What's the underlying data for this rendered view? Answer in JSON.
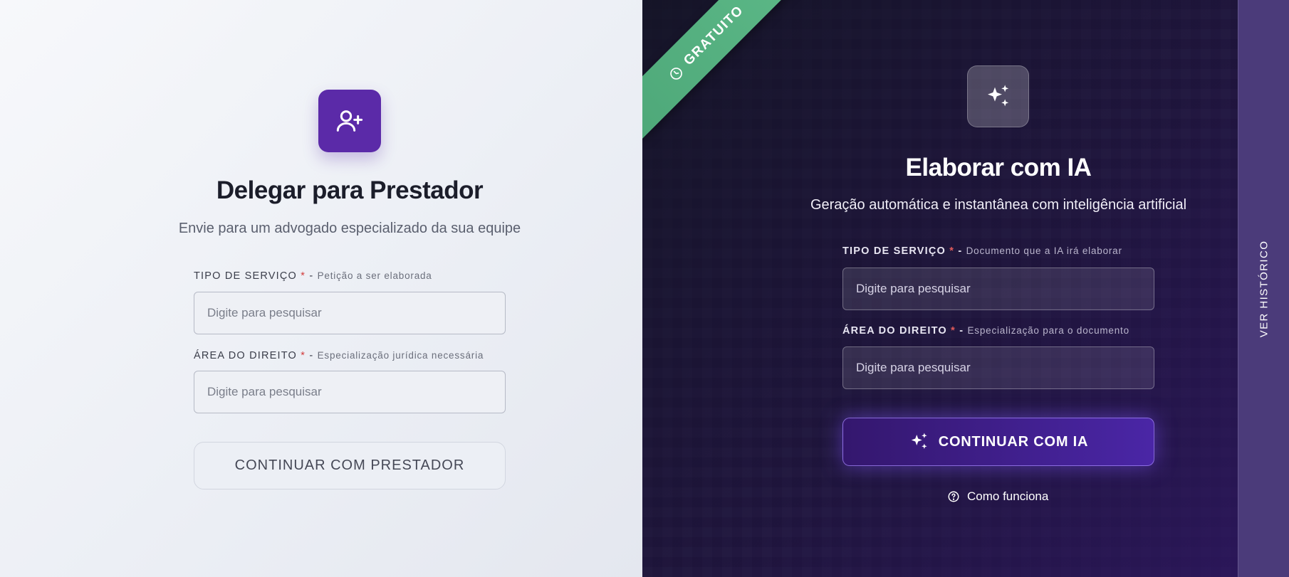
{
  "left_panel": {
    "icon": "user-plus-icon",
    "accent_color": "#5b2aa8",
    "title": "Delegar para Prestador",
    "subtitle": "Envie para um advogado especializado da sua equipe",
    "service_type": {
      "label": "TIPO DE SERVIÇO",
      "required_mark": "*",
      "separator": "-",
      "description": "Petição a ser elaborada",
      "placeholder": "Digite para pesquisar"
    },
    "law_area": {
      "label": "ÁREA DO DIREITO",
      "required_mark": "*",
      "separator": "-",
      "description": "Especialização jurídica necessária",
      "placeholder": "Digite para pesquisar"
    },
    "cta_label": "CONTINUAR COM PRESTADOR"
  },
  "right_panel": {
    "badge": "GRATUITO",
    "badge_icon": "clock-icon",
    "badge_color": "#4ea879",
    "icon": "sparkles-icon",
    "title": "Elaborar com IA",
    "subtitle": "Geração automática e instantânea com inteligência artificial",
    "service_type": {
      "label": "TIPO DE SERVIÇO",
      "required_mark": "*",
      "separator": "-",
      "description": "Documento que a IA irá elaborar",
      "placeholder": "Digite para pesquisar"
    },
    "law_area": {
      "label": "ÁREA DO DIREITO",
      "required_mark": "*",
      "separator": "-",
      "description": "Especialização para o documento",
      "placeholder": "Digite para pesquisar"
    },
    "cta_label": "CONTINUAR COM IA",
    "cta_icon": "sparkles-icon",
    "help_label": "Como funciona",
    "help_icon": "question-circle-icon",
    "accent_color": "#4a26a6"
  },
  "history_rail": {
    "label": "VER HISTÓRICO"
  }
}
